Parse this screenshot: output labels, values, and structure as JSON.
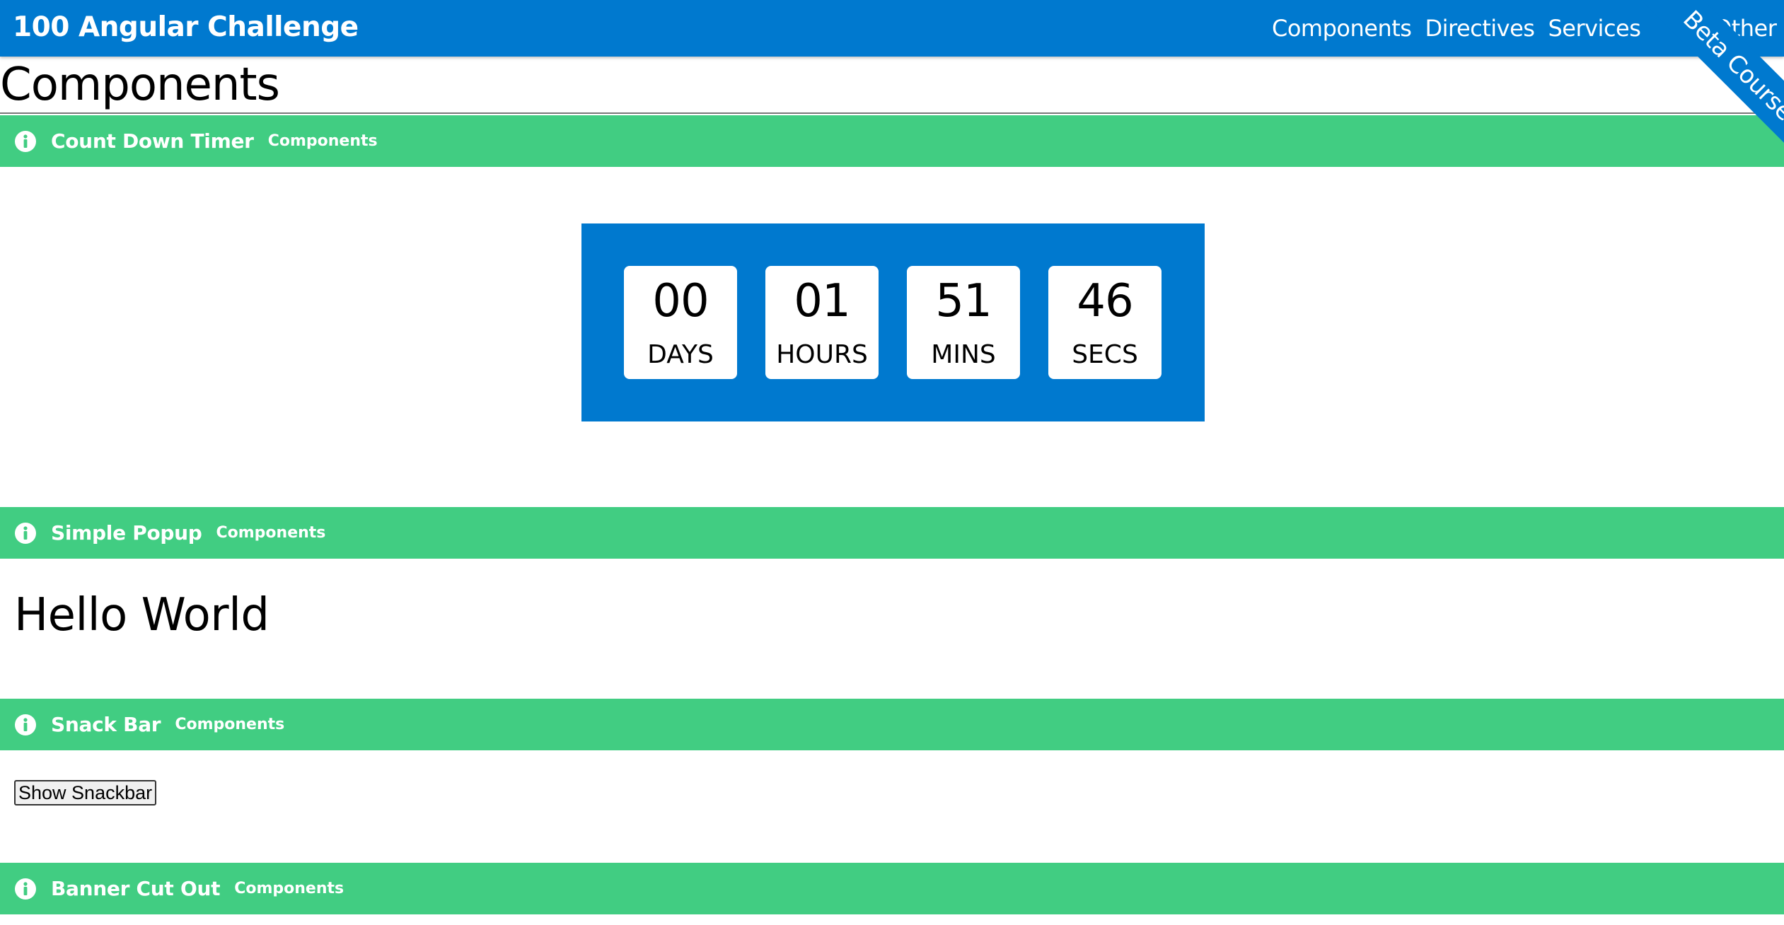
{
  "header": {
    "app_title": "100 Angular Challenge",
    "nav": [
      "Components",
      "Directives",
      "Services",
      "Other"
    ],
    "ribbon_label": "Beta Course"
  },
  "page": {
    "title": "Components"
  },
  "sections": [
    {
      "title": "Count Down Timer",
      "tag": "Components"
    },
    {
      "title": "Simple Popup",
      "tag": "Components"
    },
    {
      "title": "Snack Bar",
      "tag": "Components"
    },
    {
      "title": "Banner Cut Out",
      "tag": "Components"
    }
  ],
  "countdown": [
    {
      "value": "00",
      "unit": "DAYS"
    },
    {
      "value": "01",
      "unit": "HOURS"
    },
    {
      "value": "51",
      "unit": "MINS"
    },
    {
      "value": "46",
      "unit": "SECS"
    }
  ],
  "popup": {
    "text": "Hello World"
  },
  "snackbar": {
    "button_label": "Show Snackbar"
  },
  "colors": {
    "primary": "#0079CF",
    "section_header": "#41CD82"
  },
  "icons": {
    "section": "info-circle-icon"
  }
}
